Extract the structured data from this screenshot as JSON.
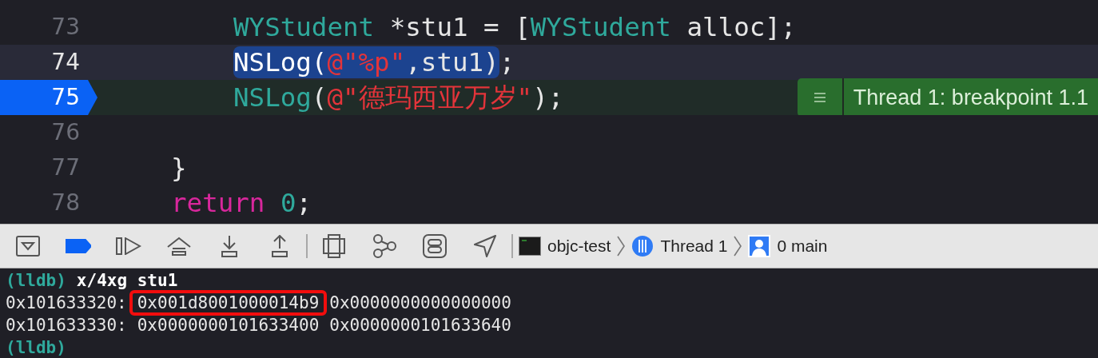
{
  "editor": {
    "lines": [
      {
        "kind": "scope",
        "children": [
          {
            "kind": "scope",
            "children": [
              {
                "kind": "line",
                "number": "73",
                "cursor": false,
                "paused": false,
                "tokens": [
                  {
                    "text": "WYStudent",
                    "kind": "type",
                    "highlight": false
                  },
                  {
                    "text": " *stu1 = [",
                    "kind": "plain",
                    "highlight": false
                  },
                  {
                    "text": "WYStudent",
                    "kind": "type",
                    "highlight": false
                  },
                  {
                    "text": " alloc];",
                    "kind": "plain",
                    "highlight": false
                  }
                ]
              },
              {
                "kind": "line",
                "number": "74",
                "cursor": true,
                "paused": false,
                "tokens": [
                  {
                    "text": "NSLog(",
                    "kind": "plain",
                    "highlight": true
                  },
                  {
                    "text": "@\"%p\"",
                    "kind": "string",
                    "highlight": true
                  },
                  {
                    "text": ",stu1)",
                    "kind": "plain",
                    "highlight": true
                  },
                  {
                    "text": ";",
                    "kind": "plain",
                    "highlight": false
                  }
                ]
              },
              {
                "kind": "line",
                "number": "75",
                "cursor": false,
                "paused": true,
                "tokens": [
                  {
                    "text": "NSLog",
                    "kind": "type",
                    "highlight": false
                  },
                  {
                    "text": "(",
                    "kind": "plain",
                    "highlight": false
                  },
                  {
                    "text": "@\"德玛西亚万岁\"",
                    "kind": "string",
                    "highlight": false
                  },
                  {
                    "text": ");",
                    "kind": "plain",
                    "highlight": false
                  }
                ],
                "annotation": "Thread 1: breakpoint 1.1"
              },
              {
                "kind": "line",
                "number": "76",
                "cursor": false,
                "paused": false
              }
            ]
          },
          {
            "kind": "line",
            "number": "77",
            "cursor": false,
            "paused": false,
            "tokens": [
              {
                "text": "}",
                "kind": "plain",
                "highlight": false
              }
            ]
          },
          {
            "kind": "line",
            "number": "78",
            "cursor": false,
            "paused": false,
            "tokens": [
              {
                "text": "return",
                "kind": "keyword",
                "highlight": false
              },
              {
                "text": "0",
                "kind": "number",
                "highlight": false,
                "space_before": true
              },
              {
                "text": ";",
                "kind": "plain",
                "highlight": false
              }
            ]
          }
        ]
      }
    ]
  },
  "debug_bar": {
    "breakpoints_active": true,
    "breadcrumbs": [
      {
        "kind": "process",
        "label": "objc-test"
      },
      {
        "kind": "thread",
        "label": "Thread 1"
      },
      {
        "kind": "frame",
        "label": "0 main"
      }
    ]
  },
  "console": {
    "lines": [
      [
        {
          "kind": "prompt",
          "text": "(lldb)"
        },
        {
          "kind": "command",
          "text": "x/4xg stu1"
        }
      ],
      [
        {
          "kind": "output",
          "text": "0x101633320:"
        },
        {
          "kind": "boxed",
          "text": "0x001d8001000014b9"
        },
        {
          "kind": "output",
          "text": "0x0000000000000000"
        }
      ],
      [
        {
          "kind": "output",
          "text": "0x101633330:"
        },
        {
          "kind": "output",
          "text": "0x0000000101633400"
        },
        {
          "kind": "output",
          "text": "0x0000000101633640"
        }
      ],
      [
        {
          "kind": "prompt",
          "text": "(lldb)"
        }
      ]
    ]
  }
}
